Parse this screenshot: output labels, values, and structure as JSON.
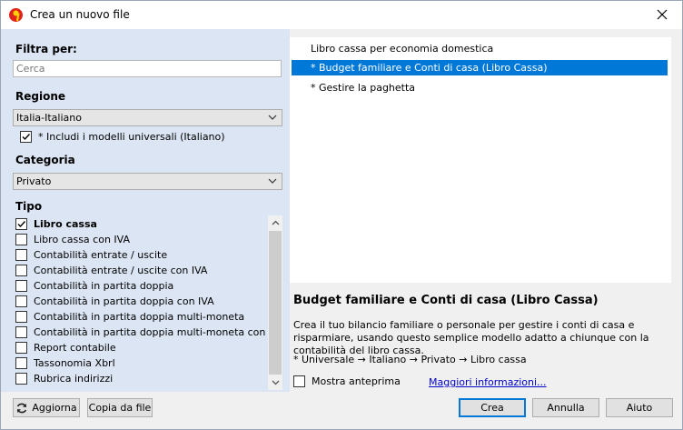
{
  "window": {
    "title": "Crea un nuovo file"
  },
  "filter": {
    "label": "Filtra per:",
    "search_placeholder": "Cerca"
  },
  "region": {
    "label": "Regione",
    "selected": "Italia-Italiano",
    "include_universal_label": "* Includi i modelli universali (Italiano)",
    "include_universal_checked": true
  },
  "category": {
    "label": "Categoria",
    "selected": "Privato"
  },
  "tipo": {
    "label": "Tipo",
    "items": [
      {
        "label": "Libro cassa",
        "checked": true
      },
      {
        "label": "Libro cassa con IVA",
        "checked": false
      },
      {
        "label": "Contabilità entrate / uscite",
        "checked": false
      },
      {
        "label": "Contabilità entrate / uscite con IVA",
        "checked": false
      },
      {
        "label": "Contabilità in partita doppia",
        "checked": false
      },
      {
        "label": "Contabilità in partita doppia con IVA",
        "checked": false
      },
      {
        "label": "Contabilità in partita doppia multi-moneta",
        "checked": false
      },
      {
        "label": "Contabilità in partita doppia multi-moneta con IVA",
        "checked": false
      },
      {
        "label": "Report contabile",
        "checked": false
      },
      {
        "label": "Tassonomia Xbrl",
        "checked": false
      },
      {
        "label": "Rubrica indirizzi",
        "checked": false
      }
    ]
  },
  "templates": {
    "items": [
      {
        "label": "Libro cassa per economia domestica",
        "selected": false
      },
      {
        "label": "* Budget familiare e Conti di casa (Libro Cassa)",
        "selected": true
      },
      {
        "label": "* Gestire la paghetta",
        "selected": false
      }
    ]
  },
  "description": {
    "title": "Budget familiare e Conti di casa (Libro Cassa)",
    "text": "Crea il tuo bilancio familiare o personale per gestire i conti di casa e risparmiare, usando questo semplice modello adatto a chiunque con la contabilità del libro cassa.",
    "path": "* Universale → Italiano → Privato → Libro cassa"
  },
  "preview": {
    "label": "Mostra anteprima",
    "checked": false
  },
  "more_info_link": "Maggiori informazioni...",
  "buttons": {
    "refresh": "Aggiorna",
    "copy_from_file": "Copia da file",
    "create": "Crea",
    "cancel": "Annulla",
    "help": "Aiuto"
  }
}
